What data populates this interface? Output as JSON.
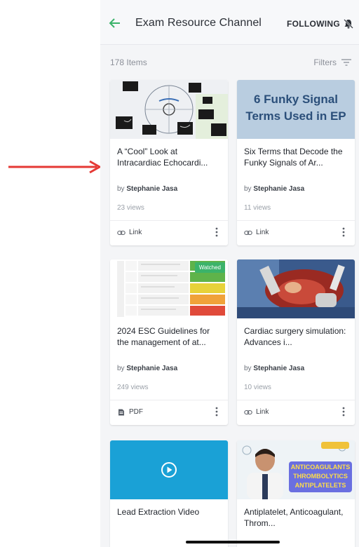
{
  "header": {
    "title": "Exam Resource Channel",
    "following_label": "FOLLOWING"
  },
  "toolbar": {
    "items_count": "178 Items",
    "filters_label": "Filters"
  },
  "cards": [
    {
      "title": "A “Cool” Look at Intracardiac Echocardi...",
      "author_prefix": "by",
      "author": "Stephanie Jasa",
      "views": "23 views",
      "type": "Link"
    },
    {
      "thumb_text": "6 Funky Signal Terms Used in EP",
      "title": "Six Terms that Decode the Funky Signals of Ar...",
      "author_prefix": "by",
      "author": "Stephanie Jasa",
      "views": "11 views",
      "type": "Link"
    },
    {
      "badge": "Watched",
      "title": "2024 ESC Guidelines for the management of at...",
      "author_prefix": "by",
      "author": "Stephanie Jasa",
      "views": "249 views",
      "type": "PDF"
    },
    {
      "title": "Cardiac surgery simulation: Advances i...",
      "author_prefix": "by",
      "author": "Stephanie Jasa",
      "views": "10 views",
      "type": "Link"
    },
    {
      "title": "Lead Extraction Video"
    },
    {
      "thumb_text": "ANTICOAGULANTS THROMBOLYTICS ANTIPLATELETS",
      "title": "Antiplatelet, Anticoagulant, Throm..."
    }
  ],
  "colors": {
    "accent_green": "#3bb36a",
    "annotation_red": "#e53935",
    "video_blue": "#1aa1d6"
  }
}
